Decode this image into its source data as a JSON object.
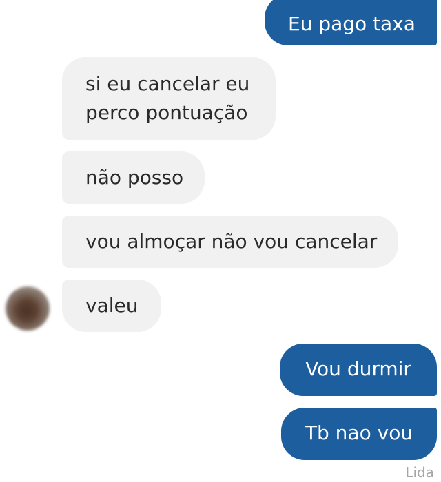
{
  "conversation": {
    "messages": [
      {
        "sender": "me",
        "text": "Eu pago taxa"
      },
      {
        "sender": "them",
        "lines": [
          "si eu cancelar eu",
          "perco pontuação"
        ]
      },
      {
        "sender": "them",
        "text": "não posso"
      },
      {
        "sender": "them",
        "text": "vou almoçar não vou cancelar"
      },
      {
        "sender": "them",
        "text": "valeu"
      },
      {
        "sender": "me",
        "text": "Vou durmir"
      },
      {
        "sender": "me",
        "text": "Tb nao vou"
      }
    ],
    "read_receipt": "Lida"
  },
  "colors": {
    "outgoing_bubble": "#1d5e9f",
    "incoming_bubble": "#f1f1f1",
    "background": "#ffffff"
  },
  "icons": {
    "avatar": "blurred-profile-photo"
  }
}
